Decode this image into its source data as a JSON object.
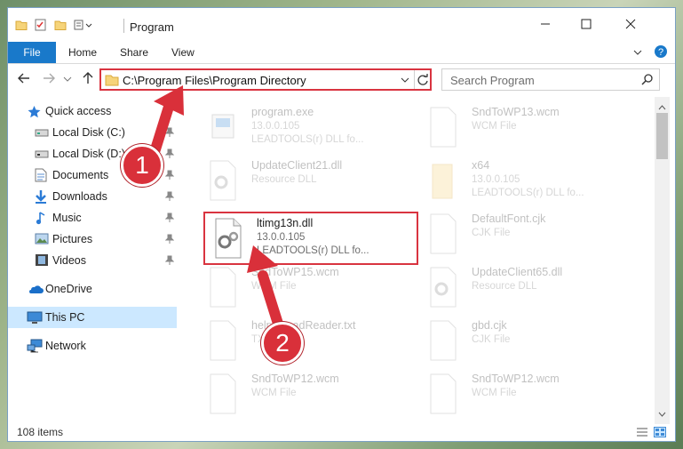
{
  "window": {
    "title": "Program",
    "icons": {
      "folder": "folder-icon",
      "properties": "properties-icon",
      "new_folder": "new-folder-icon",
      "customize": "customize-icon"
    },
    "buttons": {
      "minimize": "minimize-icon",
      "maximize": "maximize-icon",
      "close": "close-icon"
    }
  },
  "ribbon": {
    "tabs": [
      "File",
      "Home",
      "Share",
      "View"
    ],
    "accent": "#1979ca"
  },
  "nav": {
    "address": "C:\\Program Files\\Program Directory",
    "search_placeholder": "Search Program"
  },
  "sidebar": {
    "items": [
      {
        "label": "Quick access",
        "icon": "star-icon"
      },
      {
        "label": "Local Disk (C:)",
        "icon": "drive-icon"
      },
      {
        "label": "Local Disk (D:)",
        "icon": "drive-icon"
      },
      {
        "label": "Documents",
        "icon": "documents-icon"
      },
      {
        "label": "Downloads",
        "icon": "downloads-icon"
      },
      {
        "label": "Music",
        "icon": "music-icon"
      },
      {
        "label": "Pictures",
        "icon": "pictures-icon"
      },
      {
        "label": "Videos",
        "icon": "videos-icon"
      },
      {
        "label": "OneDrive",
        "icon": "onedrive-icon"
      },
      {
        "label": "This PC",
        "icon": "pc-icon"
      },
      {
        "label": "Network",
        "icon": "network-icon"
      }
    ]
  },
  "files": [
    {
      "name": "program.exe",
      "line2": "13.0.0.105",
      "line3": "LEADTOOLS(r) DLL fo...",
      "icon": "exe-icon"
    },
    {
      "name": "SndToWP13.wcm",
      "line2": "WCM File",
      "line3": "",
      "icon": "file-icon"
    },
    {
      "name": "UpdateClient21.dll",
      "line2": "Resource DLL",
      "line3": "",
      "icon": "dll-icon"
    },
    {
      "name": "x64",
      "line2": "13.0.0.105",
      "line3": "LEADTOOLS(r) DLL fo...",
      "icon": "folder-icon"
    },
    {
      "name": "ltimg13n.dll",
      "line2": "13.0.0.105",
      "line3": "LEADTOOLS(r) DLL fo...",
      "icon": "dll-icon"
    },
    {
      "name": "DefaultFont.cjk",
      "line2": "CJK File",
      "line3": "",
      "icon": "file-icon"
    },
    {
      "name": "SndToWP15.wcm",
      "line2": "WCM File",
      "line3": "",
      "icon": "file-icon"
    },
    {
      "name": "UpdateClient65.dll",
      "line2": "Resource DLL",
      "line3": "",
      "icon": "dll-icon"
    },
    {
      "name": "help_ReadReader.txt",
      "line2": "TXT File",
      "line3": "",
      "icon": "file-icon"
    },
    {
      "name": "gbd.cjk",
      "line2": "CJK File",
      "line3": "",
      "icon": "file-icon"
    },
    {
      "name": "SndToWP12.wcm",
      "line2": "WCM File",
      "line3": "",
      "icon": "file-icon"
    },
    {
      "name": "SndToWP12.wcm",
      "line2": "WCM File",
      "line3": "",
      "icon": "file-icon"
    }
  ],
  "status": {
    "count": "108 items"
  },
  "annotations": {
    "step1": "1",
    "step2": "2",
    "color": "#d9303a"
  }
}
